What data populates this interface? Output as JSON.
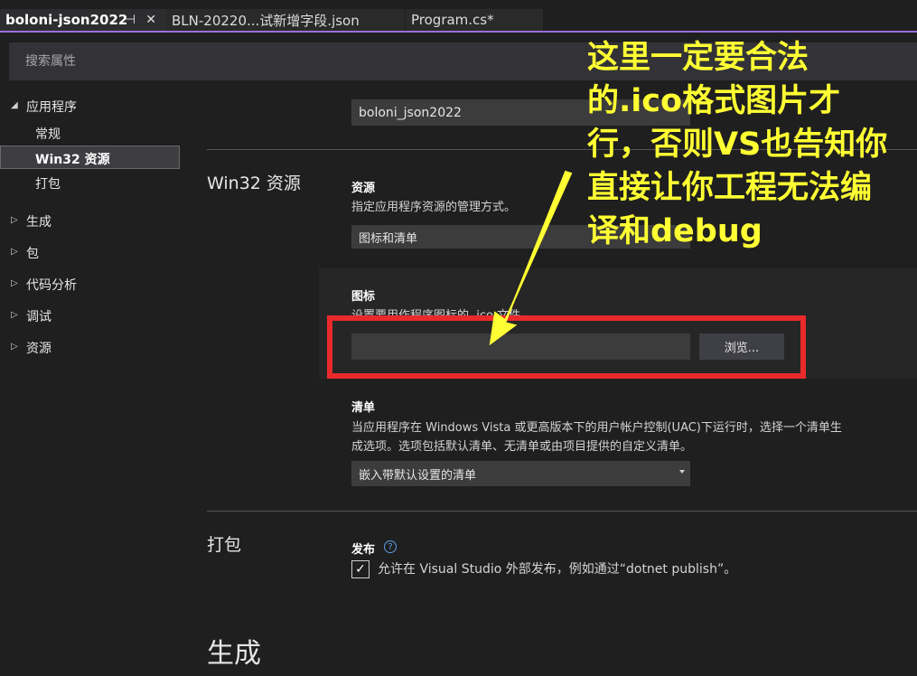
{
  "tabs": [
    {
      "label": "boloni-json2022",
      "active": true
    },
    {
      "label": "BLN-20220...试新增字段.json",
      "active": false
    },
    {
      "label": "Program.cs*",
      "active": false
    }
  ],
  "tab_icons": {
    "pin": "⊣",
    "close": "✕"
  },
  "search": {
    "placeholder": "搜索属性"
  },
  "sidebar": {
    "app_group": "应用程序",
    "app_children": [
      "常规",
      "Win32 资源",
      "打包"
    ],
    "groups": [
      "生成",
      "包",
      "代码分析",
      "调试",
      "资源"
    ]
  },
  "top_field_value": "boloni_json2022",
  "win32": {
    "section_title": "Win32 资源",
    "resources_label": "资源",
    "resources_desc": "指定应用程序资源的管理方式。",
    "resources_value": "图标和清单",
    "icon_label": "图标",
    "icon_desc": "设置要用作程序图标的 .ico 文件。",
    "icon_value": "",
    "browse_label": "浏览...",
    "manifest_label": "清单",
    "manifest_desc_1": "当应用程序在 Windows Vista 或更高版本下的用户帐户控制(UAC)下运行时，选择一个清单生",
    "manifest_desc_2": "成选项。选项包括默认清单、无清单或由项目提供的自定义清单。",
    "manifest_value": "嵌入带默认设置的清单"
  },
  "packaging": {
    "section_title": "打包",
    "publish_label": "发布",
    "help_glyph": "?",
    "checkbox_label": "允许在 Visual Studio 外部发布，例如通过“dotnet publish”。",
    "checked": true
  },
  "build_title": "生成",
  "annotation": {
    "lines": [
      "这里一定要合法",
      "的.ico格式图片才",
      "行，否则VS也告知你",
      "直接让你工程无法编",
      "译和debug"
    ],
    "color": "#ffff33",
    "box_color": "#ea2a2a"
  },
  "colors": {
    "accent": "#9b6fd6",
    "bg": "#1f1f1f"
  }
}
